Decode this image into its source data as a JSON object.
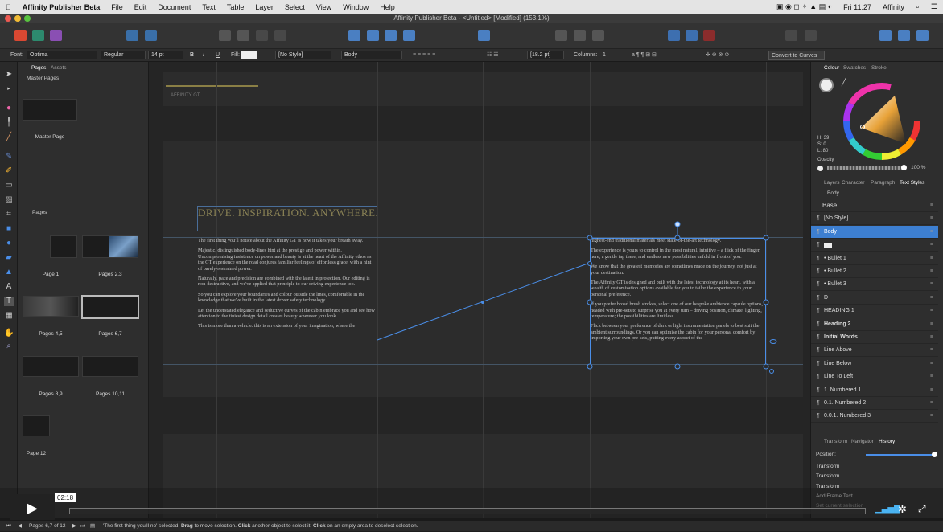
{
  "menubar": {
    "app": "Affinity Publisher Beta",
    "items": [
      "File",
      "Edit",
      "Document",
      "Text",
      "Table",
      "Layer",
      "Select",
      "View",
      "Window",
      "Help"
    ],
    "clock": "Fri 11:27",
    "user": "Affinity"
  },
  "window": {
    "title": "Affinity Publisher Beta - <Untitled> [Modified] (153.1%)"
  },
  "context": {
    "font_label": "Font:",
    "font": "Optima",
    "weight": "Regular",
    "size": "14 pt",
    "bold": "B",
    "italic": "I",
    "underline": "U",
    "fill_label": "Fill:",
    "char_style": "[No Style]",
    "para_style": "Body",
    "leading": "[18.2 pt]",
    "columns_label": "Columns:",
    "columns": "1",
    "convert": "Convert to Curves"
  },
  "pages_panel": {
    "tabs": [
      "Pages",
      "Assets"
    ],
    "master_section": "Master Pages",
    "master_name": "Master Page",
    "pages_section": "Pages",
    "spreads": [
      "Page 1",
      "Pages 2,3",
      "Pages 4,5",
      "Pages 6,7",
      "Pages 8,9",
      "Pages 10,11",
      "Page 12"
    ]
  },
  "ruler": {
    "top": [
      "40",
      "20",
      "0",
      "20",
      "40",
      "60",
      "80",
      "100",
      "120",
      "140",
      "160",
      "180",
      "200",
      "220",
      "240",
      "260",
      "280",
      "300",
      "320",
      "340",
      "360",
      "380",
      "400",
      "420",
      "440",
      "460",
      "480",
      "500",
      "520",
      "540",
      "560"
    ],
    "left": [
      "20",
      "40",
      "60",
      "80",
      "100",
      "120",
      "140",
      "160",
      "180",
      "200",
      "220",
      "240",
      "260",
      "280",
      "300",
      "320",
      "340",
      "360",
      "380",
      "400"
    ]
  },
  "canvas": {
    "footer_a": "AFFINITY GT",
    "footer_b": "AFFINITY GT",
    "headline": "DRIVE. INSPIRATION. ANYWHERE.",
    "left_paras": [
      "The first thing you'll notice about the Affinity GT is how it takes your breath away.",
      "Majestic, distinguished body-lines hint at the prestige and power within. Uncompromising insistence on power and beauty is at the heart of the Affinity ethos as the GT experience on the road conjures familiar feelings of effortless grace, with a hint of barely-restrained power.",
      "Naturally, pace and precision are combined with the latest in protection. Our editing is non-destructive, and we've applied that principle to our driving experience too.",
      "So you can explore your boundaries and colour outside the lines, comfortable in the knowledge that we've built in the latest driver safety technology.",
      "Let the understated elegance and seductive curves of the cabin embrace you and see how attention to the tiniest design detail creates beauty wherever you look.",
      "This is more than a vehicle. this is an extension of your imagination, where the"
    ],
    "right_paras": [
      "highest-end traditional materials meet state-of-the-art technology.",
      "The experience is yours to control in the most natural, intuitive – a flick of the finger, here, a gentle tap there, and endless new possibilities unfold in front of you.",
      "We know that the greatest memories are sometimes made on the journey, not just at your destination.",
      "The Affinity GT is designed and built with the latest technology at its heart, with a wealth of customisation options available for you to tailor the experience to your personal preference.",
      "If you prefer broad brush strokes, select one of our bespoke ambience capsule options, headed with pre-sets to surprise you at every turn – driving position, climate, lighting, temperature; the possibilities are limitless.",
      "Flick between your preference of dark or light instrumentation panels to best suit the ambient surroundings. Or you can optimise the cabin for your personal comfort by importing your own pre-sets, putting every aspect of the"
    ]
  },
  "right_panel": {
    "top_tabs": [
      "Colour",
      "Swatches",
      "Stroke"
    ],
    "hsl": [
      "H: 39",
      "S: 0",
      "L: 80"
    ],
    "opacity_label": "Opacity",
    "opacity_value": "100 %",
    "mid_tabs": [
      "Layers",
      "Character",
      "Paragraph",
      "Text Styles"
    ],
    "current_style": "Body",
    "styles": [
      {
        "label": "Base",
        "kind": "plain"
      },
      {
        "label": "[No Style]",
        "kind": "plain"
      },
      {
        "label": "Body",
        "kind": "selected"
      },
      {
        "label": "",
        "kind": "swatch"
      },
      {
        "label": "• Bullet 1",
        "kind": "plain"
      },
      {
        "label": "• Bullet 2",
        "kind": "plain"
      },
      {
        "label": "• Bullet 3",
        "kind": "plain"
      },
      {
        "label": "D",
        "kind": "plain"
      },
      {
        "label": "HEADING 1",
        "kind": "plain"
      },
      {
        "label": "Heading 2",
        "kind": "bold"
      },
      {
        "label": "Initial Words",
        "kind": "bold"
      },
      {
        "label": "Line Above",
        "kind": "plain"
      },
      {
        "label": "Line Below",
        "kind": "plain"
      },
      {
        "label": "Line To Left",
        "kind": "plain"
      },
      {
        "label": "1. Numbered 1",
        "kind": "plain"
      },
      {
        "label": "0.1. Numbered 2",
        "kind": "plain"
      },
      {
        "label": "0.0.1. Numbered 3",
        "kind": "plain"
      }
    ],
    "bottom_tabs": [
      "Transform",
      "Navigator",
      "History"
    ],
    "position_label": "Position:",
    "history": [
      "Transform",
      "Transform",
      "Transform",
      "Add Frame Text",
      "Set current selection"
    ]
  },
  "video": {
    "time": "02:18"
  },
  "status": {
    "pages": "Pages 6,7 of 12",
    "hint_a": "'The first thing you'll no' selected.",
    "hint_b": "Drag",
    "hint_c": "to move selection.",
    "hint_d": "Click",
    "hint_e": "another object to select it.",
    "hint_f": "Click",
    "hint_g": "on an empty area to deselect selection."
  },
  "colors": {
    "accent": "#3d7fd1",
    "selection": "#4a8ee8",
    "frame": "#5b95d6",
    "dark": "#1e1e1e"
  }
}
